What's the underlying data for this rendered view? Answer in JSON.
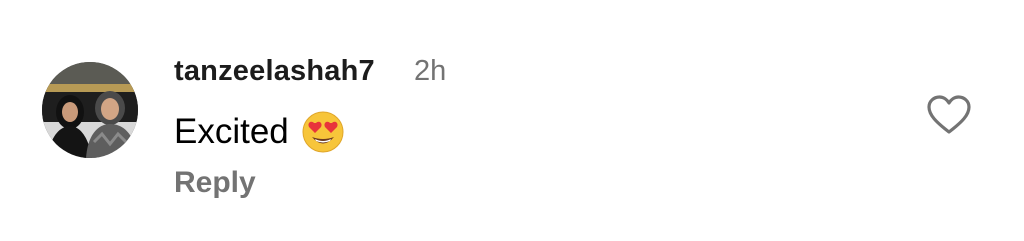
{
  "comment": {
    "username": "tanzeelashah7",
    "timestamp": "2h",
    "text": "Excited",
    "emoji": "heart-eyes-emoji",
    "reply_label": "Reply"
  },
  "icons": {
    "like": "heart-outline-icon",
    "avatar": "user-avatar"
  },
  "colors": {
    "username": "#1c1c1c",
    "secondary_text": "#737373",
    "emoji_face": "#f7c53a",
    "emoji_hearts": "#e8343b"
  }
}
